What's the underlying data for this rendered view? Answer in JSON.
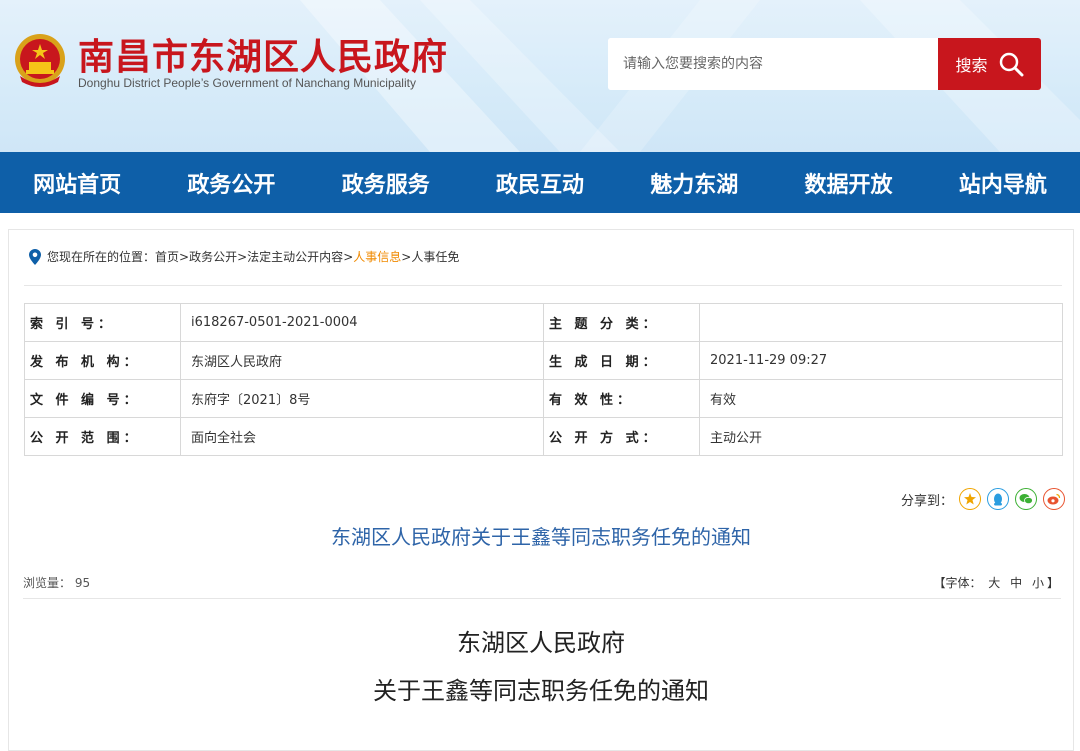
{
  "header": {
    "title": "南昌市东湖区人民政府",
    "subtitle": "Donghu District People’s Government of Nanchang Municipality",
    "search_placeholder": "请输入您要搜索的内容",
    "search_button": "搜索",
    "colors": {
      "brand_red": "#c8161d",
      "nav_blue": "#0e5fa8"
    }
  },
  "nav": {
    "items": [
      "网站首页",
      "政务公开",
      "政务服务",
      "政民互动",
      "魅力东湖",
      "数据开放",
      "站内导航"
    ]
  },
  "breadcrumb": {
    "prefix": "您现在所在的位置：",
    "items": [
      "首页",
      "政务公开",
      "法定主动公开内容",
      "人事信息",
      "人事任免"
    ],
    "separator": ">"
  },
  "meta": {
    "rows": [
      {
        "k1": "索 引 号：",
        "v1": "i618267-0501-2021-0004",
        "k2": "主 题 分 类：",
        "v2": ""
      },
      {
        "k1": "发 布 机 构：",
        "v1": "东湖区人民政府",
        "k2": "生 成 日 期：",
        "v2": "2021-11-29 09:27"
      },
      {
        "k1": "文 件 编 号：",
        "v1": "东府字〔2021〕8号",
        "k2": "有 效 性：",
        "v2": "有效"
      },
      {
        "k1": "公 开 范 围：",
        "v1": "面向全社会",
        "k2": "公 开 方 式：",
        "v2": "主动公开"
      }
    ]
  },
  "share": {
    "label": "分享到：",
    "icons": [
      "qzone-icon",
      "qq-icon",
      "wechat-icon",
      "weibo-icon"
    ]
  },
  "article": {
    "title": "东湖区人民政府关于王鑫等同志职务任免的通知",
    "views_label": "浏览量：",
    "views": "95",
    "font_label": "【字体：",
    "font_options": [
      "大",
      "中",
      "小"
    ],
    "font_close": "】",
    "heading_line1": "东湖区人民政府",
    "heading_line2": "关于王鑫等同志职务任免的通知"
  }
}
